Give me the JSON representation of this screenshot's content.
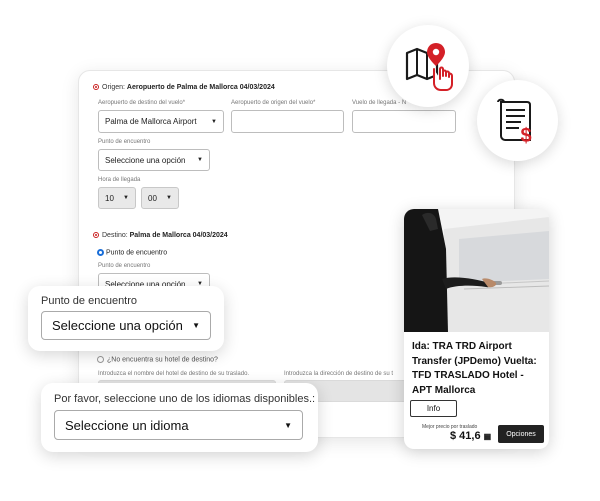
{
  "origin": {
    "prefix": "Origen: ",
    "title": "Aeropuerto de Palma de Mallorca 04/03/2024",
    "dest_airport_label": "Aeropuerto de destino del vuelo*",
    "dest_airport_value": "Palma de Mallorca Airport",
    "origin_airport_label": "Aeropuerto de origen del vuelo*",
    "arrival_flight_label": "Vuelo de llegada - N",
    "meeting_point_label": "Punto de encuentro",
    "meeting_point_value": "Seleccione una opción",
    "arrival_time_label": "Hora de llegada",
    "hour_value": "10",
    "minute_value": "00"
  },
  "destination": {
    "prefix": "Destino: ",
    "title": "Palma de Mallorca 04/03/2024",
    "radio_meeting_point": "Punto de encuentro",
    "meeting_point_label": "Punto de encuentro",
    "meeting_point_value": "Seleccione una opción",
    "hotel_not_found": "¿No encuentra su hotel de destino?",
    "hotel_name_label": "Introduzca el nombre del hotel de destino de su traslado.",
    "hotel_address_label": "Introduzca la dirección de destino de su t"
  },
  "popup_meeting": {
    "label": "Punto de encuentro",
    "value": "Seleccione una opción"
  },
  "popup_language": {
    "label": "Por favor, seleccione uno de los idiomas disponibles.:",
    "value": "Seleccione un idioma"
  },
  "product": {
    "description": "Ida: TRA TRD Airport Transfer (JPDemo) Vuelta: TFD TRASLADO Hotel - APT Mallorca",
    "info_button": "Info",
    "price_label": "Mejor precio por traslado",
    "price": "$ 41,6",
    "options_button": "Opciones"
  },
  "icons": {
    "map": "map-pointer-icon",
    "invoice": "invoice-dollar-icon",
    "accent_color": "#d42027"
  }
}
